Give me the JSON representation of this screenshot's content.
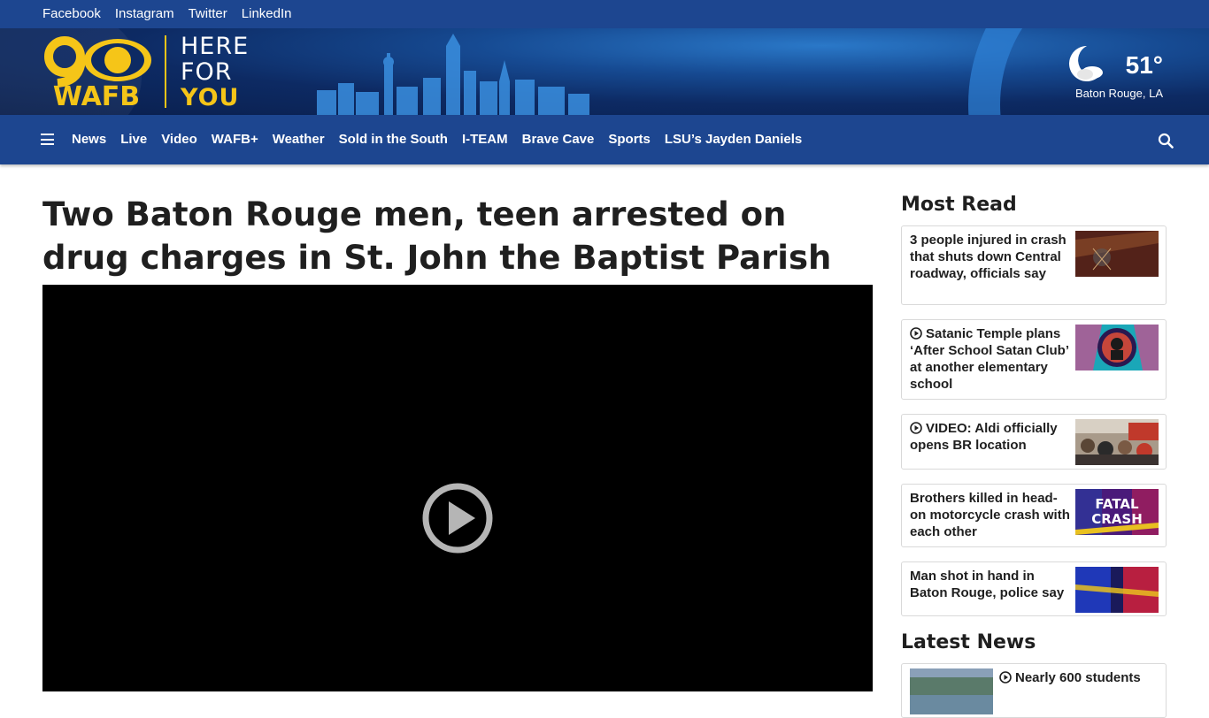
{
  "social": [
    "Facebook",
    "Instagram",
    "Twitter",
    "LinkedIn"
  ],
  "brand": {
    "logo_number": "9",
    "logo_text": "WAFB",
    "tagline": [
      "HERE",
      "FOR",
      "YOU"
    ]
  },
  "weather": {
    "temp": "51°",
    "location": "Baton Rouge, LA",
    "icon": "moon-cloud-icon"
  },
  "nav": {
    "items": [
      "News",
      "Live",
      "Video",
      "WAFB+",
      "Weather",
      "Sold in the South",
      "I-TEAM",
      "Brave Cave",
      "Sports",
      "LSU’s Jayden Daniels"
    ],
    "menu_icon": "hamburger-icon",
    "search_icon": "search-icon"
  },
  "article": {
    "headline": "Two Baton Rouge men, teen arrested on drug charges in St. John the Baptist Parish",
    "video_icon": "play-icon"
  },
  "most_read": {
    "title": "Most Read",
    "items": [
      {
        "text": "3 people injured in crash that shuts down Central roadway, officials say",
        "video": false,
        "thumb": "crash-debris"
      },
      {
        "text": "Satanic Temple plans ‘After School Satan Club’ at another elementary school",
        "video": true,
        "thumb": "satan-club-logo"
      },
      {
        "text": "VIDEO: Aldi officially opens BR location",
        "video": true,
        "thumb": "store-crowd"
      },
      {
        "text": "Brothers killed in head-on motorcycle crash with each other",
        "video": false,
        "thumb": "fatal-crash-graphic"
      },
      {
        "text": "Man shot in hand in Baton Rouge, police say",
        "video": false,
        "thumb": "police-tape"
      }
    ]
  },
  "latest_news": {
    "title": "Latest News",
    "items": [
      {
        "text": "Nearly 600 students",
        "video": true
      }
    ]
  },
  "thumb_text": {
    "fatal": "FATAL",
    "crash": "CRASH"
  },
  "colors": {
    "nav_blue": "#1d4690",
    "accent_yellow": "#f5c518"
  }
}
